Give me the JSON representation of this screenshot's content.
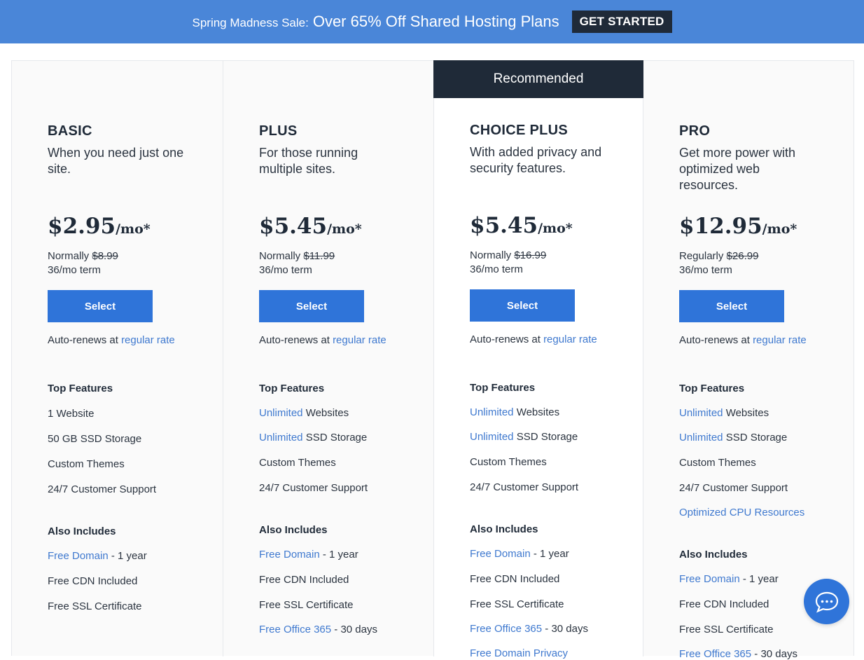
{
  "banner": {
    "prefix": "Spring Madness Sale:",
    "main": "Over 65% Off Shared Hosting Plans",
    "cta": "GET STARTED"
  },
  "recommended_label": "Recommended",
  "colors": {
    "banner": "#4a86d8",
    "dark": "#1f2a38",
    "button": "#2f74d9",
    "link": "#3f79cf"
  },
  "plans": [
    {
      "name": "BASIC",
      "desc": "When you need just one site.",
      "price": "$2.95",
      "unit": "/mo*",
      "normal_label": "Normally",
      "normal_price": "$8.99",
      "term": "36/mo term",
      "select": "Select",
      "renew_text": "Auto-renews at",
      "renew_link": "regular rate",
      "top_title": "Top Features",
      "top_features": [
        {
          "link": "",
          "text": "1 Website"
        },
        {
          "link": "",
          "text": "50 GB SSD Storage"
        },
        {
          "link": "",
          "text": "Custom Themes"
        },
        {
          "link": "",
          "text": "24/7 Customer Support"
        }
      ],
      "also_title": "Also Includes",
      "also": [
        {
          "link": "Free Domain",
          "text": " - 1 year"
        },
        {
          "link": "",
          "text": "Free CDN Included"
        },
        {
          "link": "",
          "text": "Free SSL Certificate"
        }
      ]
    },
    {
      "name": "PLUS",
      "desc": "For those running multiple sites.",
      "price": "$5.45",
      "unit": "/mo*",
      "normal_label": "Normally",
      "normal_price": "$11.99",
      "term": "36/mo term",
      "select": "Select",
      "renew_text": "Auto-renews at",
      "renew_link": "regular rate",
      "top_title": "Top Features",
      "top_features": [
        {
          "link": "Unlimited",
          "text": " Websites"
        },
        {
          "link": "Unlimited",
          "text": " SSD Storage"
        },
        {
          "link": "",
          "text": "Custom Themes"
        },
        {
          "link": "",
          "text": "24/7 Customer Support"
        }
      ],
      "also_title": "Also Includes",
      "also": [
        {
          "link": "Free Domain",
          "text": " - 1 year"
        },
        {
          "link": "",
          "text": "Free CDN Included"
        },
        {
          "link": "",
          "text": "Free SSL Certificate"
        },
        {
          "link": "Free Office 365",
          "text": " - 30 days"
        }
      ]
    },
    {
      "name": "CHOICE PLUS",
      "desc": "With added privacy and security features.",
      "price": "$5.45",
      "unit": "/mo*",
      "normal_label": "Normally",
      "normal_price": "$16.99",
      "term": "36/mo term",
      "select": "Select",
      "renew_text": "Auto-renews at",
      "renew_link": "regular rate",
      "top_title": "Top Features",
      "top_features": [
        {
          "link": "Unlimited",
          "text": " Websites"
        },
        {
          "link": "Unlimited",
          "text": " SSD Storage"
        },
        {
          "link": "",
          "text": "Custom Themes"
        },
        {
          "link": "",
          "text": "24/7 Customer Support"
        }
      ],
      "also_title": "Also Includes",
      "also": [
        {
          "link": "Free Domain",
          "text": " - 1 year"
        },
        {
          "link": "",
          "text": "Free CDN Included"
        },
        {
          "link": "",
          "text": "Free SSL Certificate"
        },
        {
          "link": "Free Office 365",
          "text": " - 30 days"
        },
        {
          "link": "Free Domain Privacy",
          "text": ""
        }
      ]
    },
    {
      "name": "PRO",
      "desc": "Get more power with optimized web resources.",
      "price": "$12.95",
      "unit": "/mo*",
      "normal_label": "Regularly",
      "normal_price": "$26.99",
      "term": "36/mo term",
      "select": "Select",
      "renew_text": "Auto-renews at",
      "renew_link": "regular rate",
      "top_title": "Top Features",
      "top_features": [
        {
          "link": "Unlimited",
          "text": " Websites"
        },
        {
          "link": "Unlimited",
          "text": " SSD Storage"
        },
        {
          "link": "",
          "text": "Custom Themes"
        },
        {
          "link": "",
          "text": "24/7 Customer Support"
        },
        {
          "link": "Optimized CPU Resources",
          "text": ""
        }
      ],
      "also_title": "Also Includes",
      "also": [
        {
          "link": "Free Domain",
          "text": " - 1 year"
        },
        {
          "link": "",
          "text": "Free CDN Included"
        },
        {
          "link": "",
          "text": "Free SSL Certificate"
        },
        {
          "link": "Free Office 365",
          "text": " - 30 days"
        }
      ]
    }
  ],
  "chat_icon": "chat-bubble-icon"
}
